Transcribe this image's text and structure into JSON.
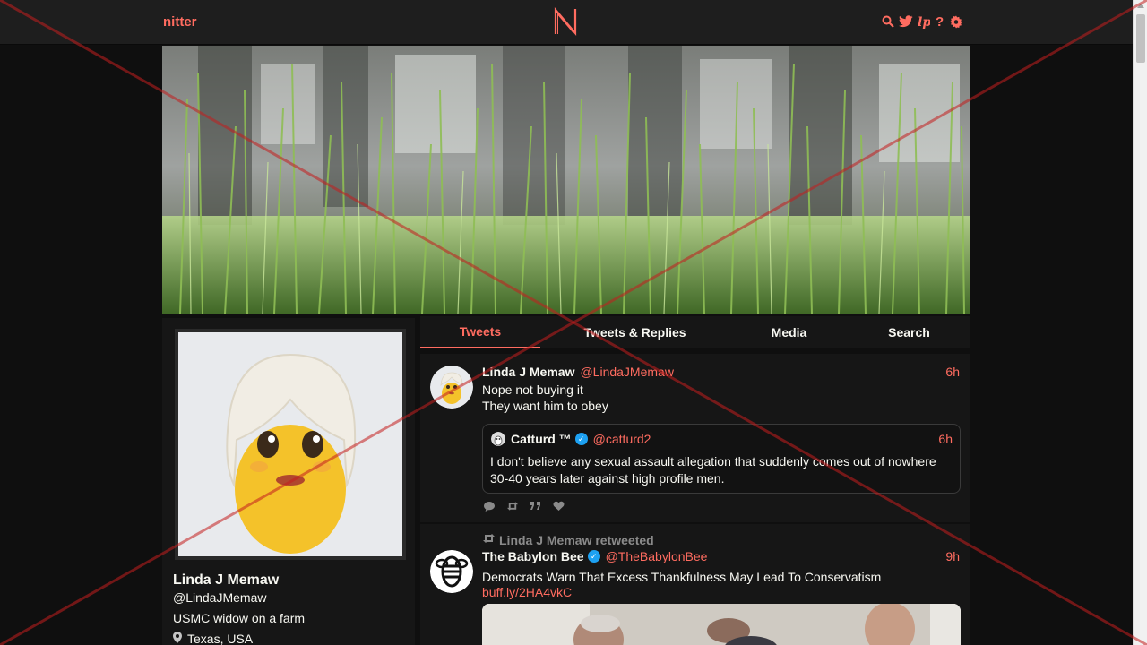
{
  "nav": {
    "brand": "nitter",
    "logo_letter": "N",
    "icons": [
      "search-icon",
      "twitter-bird-icon",
      "liberapay-icon",
      "help-icon",
      "gear-icon"
    ]
  },
  "colors": {
    "accent": "#ff6c60",
    "background": "#0f0f0f",
    "panel": "#161616",
    "nav": "#1e1e1e",
    "verified": "#1da1f2",
    "overlay_x": "#c41e1e"
  },
  "profile": {
    "name": "Linda J Memaw",
    "handle": "@LindaJMemaw",
    "bio": "USMC widow on a farm",
    "location": "Texas, USA"
  },
  "tabs": [
    {
      "label": "Tweets",
      "active": true
    },
    {
      "label": "Tweets & Replies",
      "active": false
    },
    {
      "label": "Media",
      "active": false
    },
    {
      "label": "Search",
      "active": false
    }
  ],
  "tweets": [
    {
      "name": "Linda J Memaw",
      "handle": "@LindaJMemaw",
      "time": "6h",
      "lines": [
        "Nope not buying it",
        "They want him to obey"
      ],
      "quote": {
        "name": "Catturd ™",
        "handle": "@catturd2",
        "time": "6h",
        "text": "I don't believe any sexual assault allegation that suddenly comes out of nowhere 30-40 years later against high profile men."
      }
    },
    {
      "retweet_label": "Linda J Memaw retweeted",
      "name": "The Babylon Bee",
      "handle": "@TheBabylonBee",
      "time": "9h",
      "text": "Democrats Warn That Excess Thankfulness May Lead To Conservatism",
      "link": "buff.ly/2HA4vkC"
    }
  ]
}
